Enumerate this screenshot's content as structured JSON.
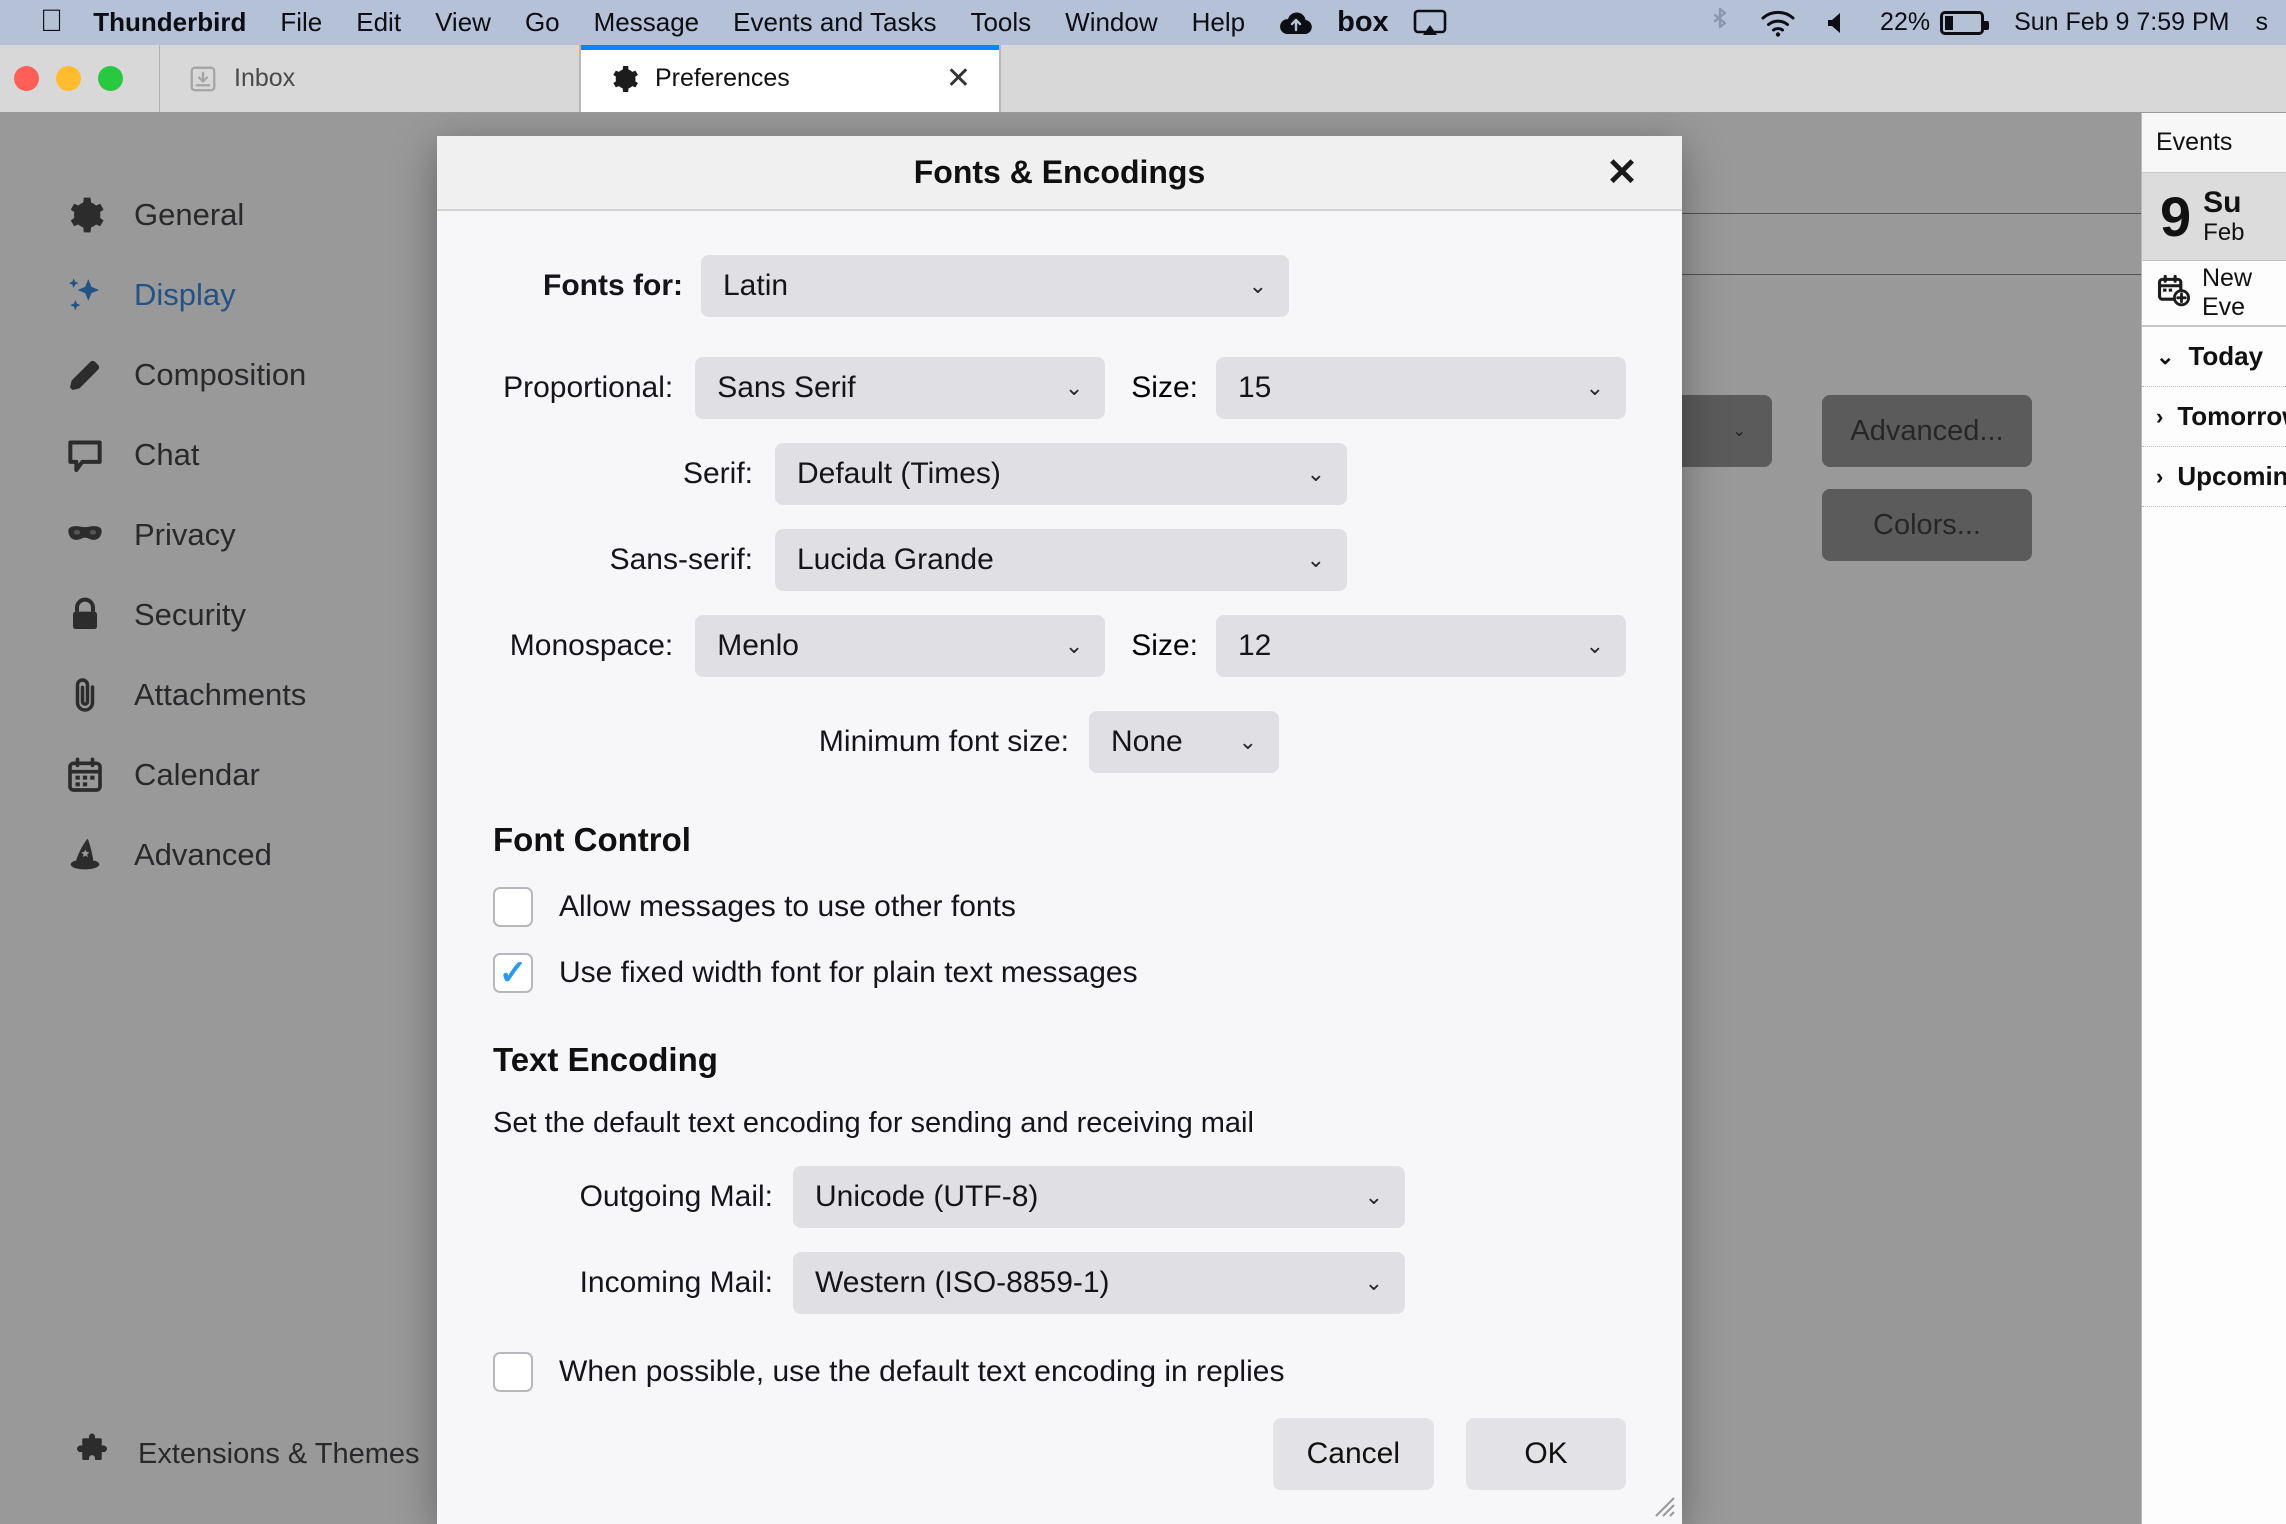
{
  "menubar": {
    "apple_icon": "apple-logo-icon",
    "items": [
      {
        "label": "Thunderbird",
        "bold": true
      },
      {
        "label": "File",
        "bold": false
      },
      {
        "label": "Edit",
        "bold": false
      },
      {
        "label": "View",
        "bold": false
      },
      {
        "label": "Go",
        "bold": false
      },
      {
        "label": "Message",
        "bold": false
      },
      {
        "label": "Events and Tasks",
        "bold": false
      },
      {
        "label": "Tools",
        "bold": false
      },
      {
        "label": "Window",
        "bold": false
      },
      {
        "label": "Help",
        "bold": false
      }
    ],
    "status_icons": [
      "cloud-upload-icon",
      "box-icon",
      "airplay-icon",
      "bluetooth-icon",
      "wifi-icon",
      "volume-icon"
    ],
    "box_label": "box",
    "battery_percent": "22%",
    "clock": "Sun Feb 9  7:59 PM",
    "edge_char": "s"
  },
  "tabs": [
    {
      "label": "Inbox",
      "icon": "inbox-icon",
      "active": false,
      "closable": false
    },
    {
      "label": "Preferences",
      "icon": "gear-icon",
      "active": true,
      "closable": true,
      "close_glyph": "✕"
    }
  ],
  "sidebar": {
    "items": [
      {
        "label": "General",
        "icon": "gear-icon",
        "selected": false
      },
      {
        "label": "Display",
        "icon": "sparkle-icon",
        "selected": true
      },
      {
        "label": "Composition",
        "icon": "pencil-icon",
        "selected": false
      },
      {
        "label": "Chat",
        "icon": "chat-bubble-icon",
        "selected": false
      },
      {
        "label": "Privacy",
        "icon": "mask-icon",
        "selected": false
      },
      {
        "label": "Security",
        "icon": "lock-icon",
        "selected": false
      },
      {
        "label": "Attachments",
        "icon": "paperclip-icon",
        "selected": false
      },
      {
        "label": "Calendar",
        "icon": "calendar-icon",
        "selected": false
      },
      {
        "label": "Advanced",
        "icon": "wizard-hat-icon",
        "selected": false
      }
    ],
    "bottom": {
      "label": "Extensions & Themes",
      "icon": "puzzle-piece-icon"
    }
  },
  "background_prefs": {
    "advanced_button": "Advanced...",
    "colors_button": "Colors..."
  },
  "dialog": {
    "title": "Fonts & Encodings",
    "close_glyph": "✕",
    "fonts_for": {
      "label": "Fonts for:",
      "value": "Latin",
      "chevron": "⌄"
    },
    "font_rows": [
      {
        "label": "Proportional:",
        "value": "Sans Serif",
        "has_size": true,
        "size_label": "Size:",
        "size_value": "15"
      },
      {
        "label": "Serif:",
        "value": "Default (Times)",
        "has_size": false,
        "size_label": "",
        "size_value": ""
      },
      {
        "label": "Sans-serif:",
        "value": "Lucida Grande",
        "has_size": false,
        "size_label": "",
        "size_value": ""
      },
      {
        "label": "Monospace:",
        "value": "Menlo",
        "has_size": true,
        "size_label": "Size:",
        "size_value": "12"
      }
    ],
    "minimum_font_size": {
      "label": "Minimum font size:",
      "value": "None"
    },
    "font_control": {
      "title": "Font Control",
      "checkboxes": [
        {
          "label": "Allow messages to use other fonts",
          "checked": false
        },
        {
          "label": "Use fixed width font for plain text messages",
          "checked": true
        }
      ]
    },
    "text_encoding": {
      "title": "Text Encoding",
      "description": "Set the default text encoding for sending and receiving mail",
      "rows": [
        {
          "label": "Outgoing Mail:",
          "value": "Unicode (UTF-8)"
        },
        {
          "label": "Incoming Mail:",
          "value": "Western (ISO-8859-1)"
        }
      ],
      "reply_checkbox": {
        "label": "When possible, use the default text encoding in replies",
        "checked": false
      }
    },
    "buttons": {
      "cancel": "Cancel",
      "ok": "OK"
    }
  },
  "events_pane": {
    "header": "Events",
    "day_number": "9",
    "day_of_week": "Su",
    "month": "Feb",
    "new_event": "New Eve",
    "groups": [
      {
        "label": "Today",
        "expanded": true,
        "chevron": "⌄"
      },
      {
        "label": "Tomorrow",
        "expanded": false,
        "chevron": "›"
      },
      {
        "label": "Upcomin",
        "expanded": false,
        "chevron": "›"
      }
    ]
  },
  "colors": {
    "accent": "#0a84ff",
    "selected_sidebar": "#0a6cd8",
    "checkbox_check": "#2b9ae8",
    "menubar_bg": "#b5c1d6"
  }
}
